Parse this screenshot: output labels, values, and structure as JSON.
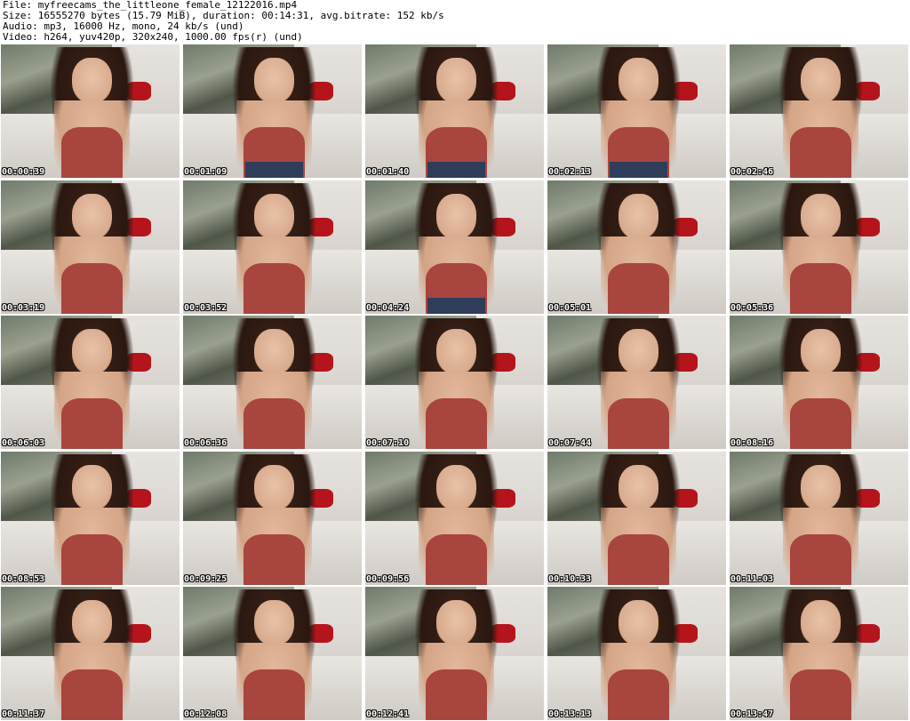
{
  "info": {
    "file": "File: myfreecams_the_littleone_female_12122016.mp4",
    "size": "Size: 16555270 bytes (15.79 MiB), duration: 00:14:31, avg.bitrate: 152 kb/s",
    "audio": "Audio: mp3, 16000 Hz, mono, 24 kb/s (und)",
    "video": "Video: h264, yuv420p, 320x240, 1000.00 fps(r) (und)"
  },
  "thumbnails": [
    {
      "timestamp": "00:00:39"
    },
    {
      "timestamp": "00:01:09"
    },
    {
      "timestamp": "00:01:40"
    },
    {
      "timestamp": "00:02:13"
    },
    {
      "timestamp": "00:02:46"
    },
    {
      "timestamp": "00:03:19"
    },
    {
      "timestamp": "00:03:52"
    },
    {
      "timestamp": "00:04:24"
    },
    {
      "timestamp": "00:05:01"
    },
    {
      "timestamp": "00:05:36"
    },
    {
      "timestamp": "00:06:03"
    },
    {
      "timestamp": "00:06:36"
    },
    {
      "timestamp": "00:07:10"
    },
    {
      "timestamp": "00:07:44"
    },
    {
      "timestamp": "00:08:16"
    },
    {
      "timestamp": "00:08:53"
    },
    {
      "timestamp": "00:09:25"
    },
    {
      "timestamp": "00:09:56"
    },
    {
      "timestamp": "00:10:33"
    },
    {
      "timestamp": "00:11:03"
    },
    {
      "timestamp": "00:11:37"
    },
    {
      "timestamp": "00:12:08"
    },
    {
      "timestamp": "00:12:41"
    },
    {
      "timestamp": "00:13:13"
    },
    {
      "timestamp": "00:13:47"
    }
  ],
  "colors": {
    "top": "#a8453f",
    "shorts": "#2f3d5a",
    "wall_red": "#b5141c",
    "background": "#ffffff"
  }
}
